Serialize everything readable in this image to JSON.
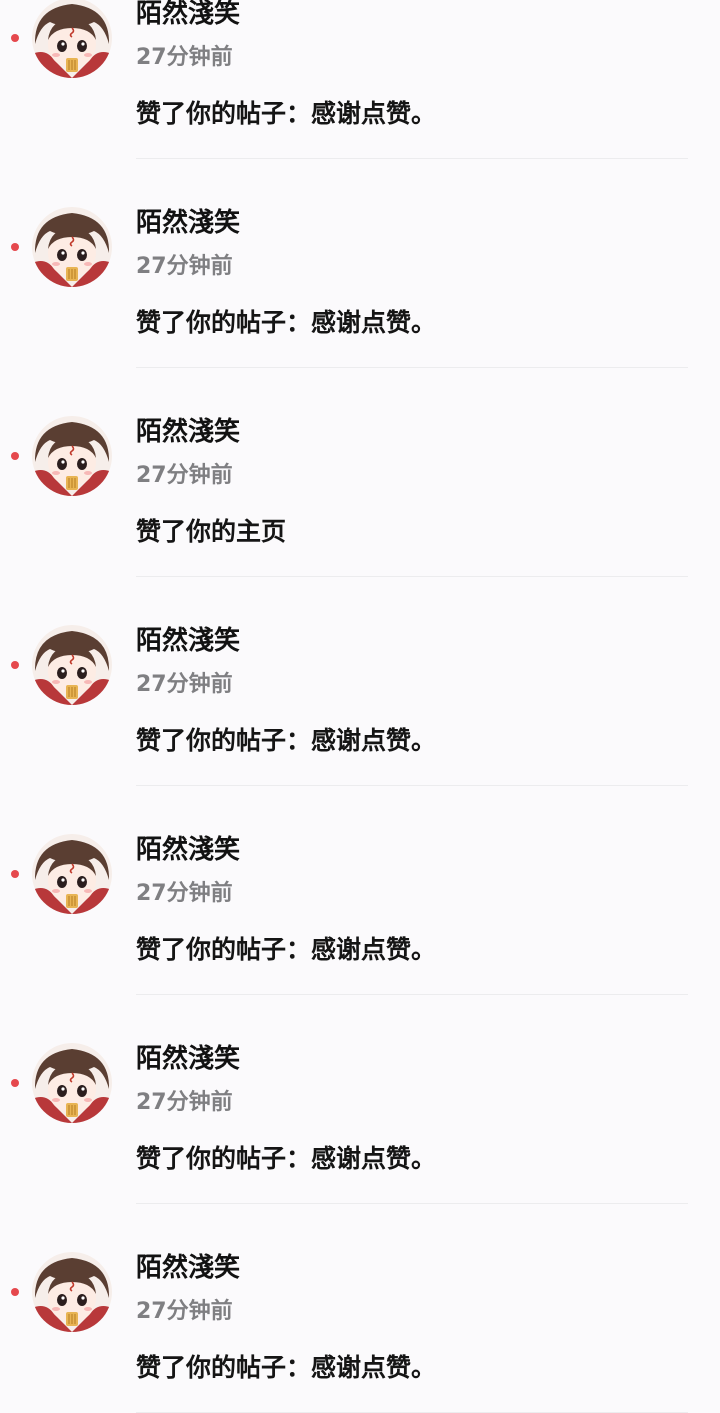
{
  "notifications": [
    {
      "user": "陌然淺笑",
      "time": "27分钟前",
      "action": "赞了你的帖子：感谢点赞。"
    },
    {
      "user": "陌然淺笑",
      "time": "27分钟前",
      "action": "赞了你的帖子：感谢点赞。"
    },
    {
      "user": "陌然淺笑",
      "time": "27分钟前",
      "action": "赞了你的主页"
    },
    {
      "user": "陌然淺笑",
      "time": "27分钟前",
      "action": "赞了你的帖子：感谢点赞。"
    },
    {
      "user": "陌然淺笑",
      "time": "27分钟前",
      "action": "赞了你的帖子：感谢点赞。"
    },
    {
      "user": "陌然淺笑",
      "time": "27分钟前",
      "action": "赞了你的帖子：感谢点赞。"
    },
    {
      "user": "陌然淺笑",
      "time": "27分钟前",
      "action": "赞了你的帖子：感谢点赞。"
    }
  ],
  "colors": {
    "unread_dot": "#e5484d",
    "background": "#fbfafc",
    "divider": "#ececee"
  }
}
